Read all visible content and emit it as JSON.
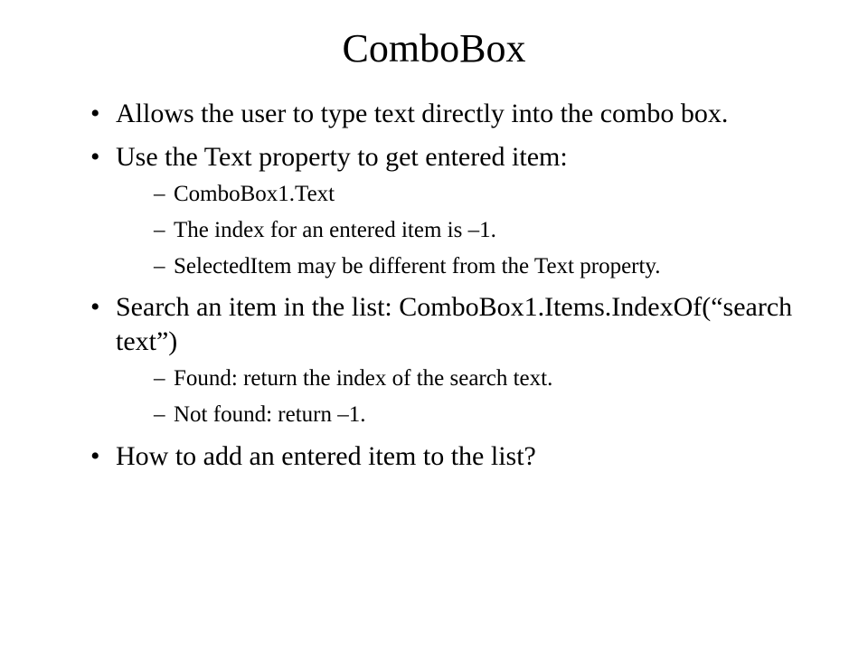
{
  "title": "ComboBox",
  "bullets": {
    "b1": "Allows the user to type text directly into the combo box.",
    "b2": "Use the Text property to get entered item:",
    "b2_subs": {
      "s1": "ComboBox1.Text",
      "s2": "The index for an entered item is –1.",
      "s3": "SelectedItem may be different from the Text property."
    },
    "b3": "Search an item in the list: ComboBox1.Items.IndexOf(“search text”)",
    "b3_subs": {
      "s1": "Found: return the index of the search text.",
      "s2": "Not found: return –1."
    },
    "b4": "How to add an entered item to the list?"
  }
}
